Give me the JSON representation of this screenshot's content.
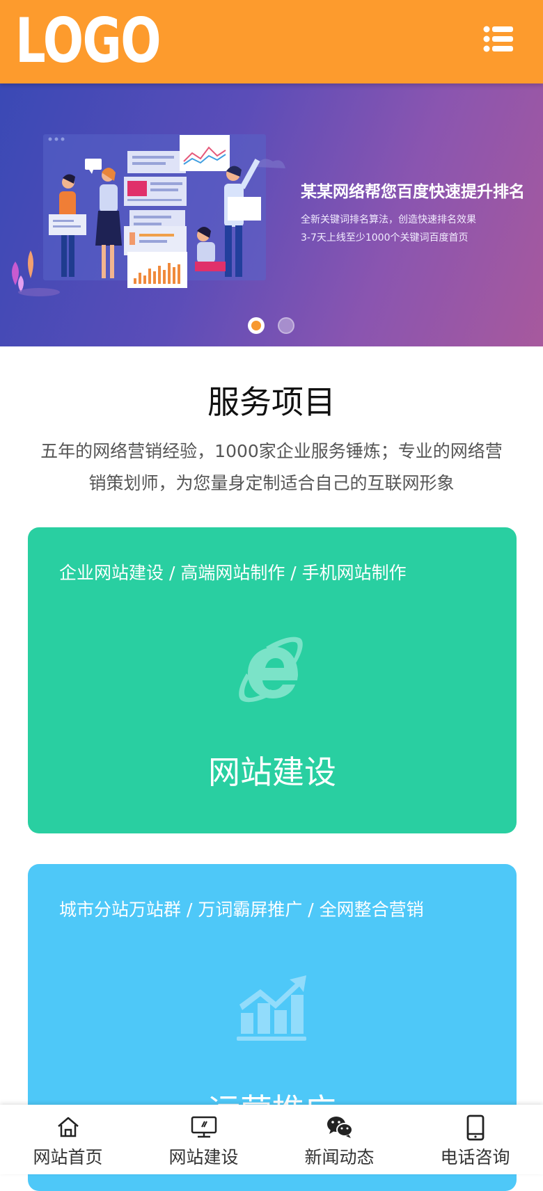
{
  "header": {
    "logo_text": "LOGO",
    "menu_icon": "list-menu-icon",
    "bg_color": "#fd9b2d"
  },
  "banner": {
    "title": "某某网络帮您百度快速提升排名",
    "line1": "全新关键词排名算法，创造快速排名效果",
    "line2": "3-7天上线至少1000个关键词百度首页",
    "slides_count": 2,
    "active_slide": 1
  },
  "services": {
    "title": "服务项目",
    "description": "五年的网络营销经验，1000家企业服务锤炼；专业的网络营销策划师，为您量身定制适合自己的互联网形象"
  },
  "cards": [
    {
      "tags": "企业网站建设 / 高端网站制作 / 手机网站制作",
      "icon": "ie-browser-icon",
      "name": "网站建设",
      "color": "#29cfa1"
    },
    {
      "tags": "城市分站万站群 / 万词霸屏推广 / 全网整合营销",
      "icon": "growth-chart-icon",
      "name": "运营推广",
      "color": "#4ec8f8"
    }
  ],
  "bottom_nav": [
    {
      "label": "网站首页",
      "icon": "home-icon"
    },
    {
      "label": "网站建设",
      "icon": "monitor-icon"
    },
    {
      "label": "新闻动态",
      "icon": "wechat-icon"
    },
    {
      "label": "电话咨询",
      "icon": "phone-icon"
    }
  ]
}
